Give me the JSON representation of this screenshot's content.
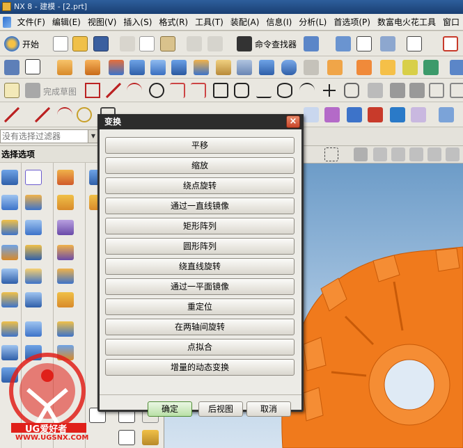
{
  "window": {
    "title": "NX 8 - 建模 - [2.prt]"
  },
  "menu": [
    "文件(F)",
    "编辑(E)",
    "视图(V)",
    "插入(S)",
    "格式(R)",
    "工具(T)",
    "装配(A)",
    "信息(I)",
    "分析(L)",
    "首选项(P)",
    "数富电火花工具",
    "窗口"
  ],
  "toolbar": {
    "start_label": "开始",
    "command_finder_label": "命令查找器",
    "sketch_label": "完成草图"
  },
  "filter": {
    "placeholder": "没有选择过滤器"
  },
  "left_panel": {
    "title": "选择选项"
  },
  "dialog": {
    "title": "变换",
    "options": [
      "平移",
      "缩放",
      "绕点旋转",
      "通过一直线镜像",
      "矩形阵列",
      "圆形阵列",
      "绕直线旋转",
      "通过一平面镜像",
      "重定位",
      "在两轴间旋转",
      "点拟合",
      "增量的动态变换"
    ],
    "ok_label": "确定",
    "back_label": "后视图",
    "cancel_label": "取消"
  },
  "watermark": {
    "brand": "UG爱好者",
    "url": "WWW.UGSNX.COM"
  },
  "colors": {
    "part": "#f07a1c",
    "accent": "#2c6fd0",
    "dialog_frame": "#333333",
    "close": "#c8452a"
  }
}
